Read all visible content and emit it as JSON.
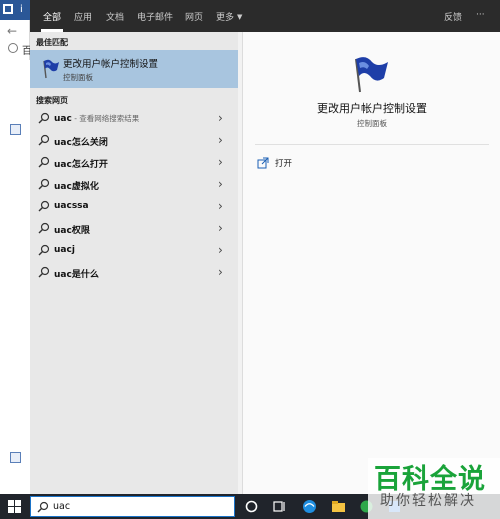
{
  "background_window": {
    "title_fragment": "i",
    "tab_fragment": "百"
  },
  "filter_tabs": [
    {
      "label": "全部",
      "active": true
    },
    {
      "label": "应用"
    },
    {
      "label": "文档"
    },
    {
      "label": "电子邮件"
    },
    {
      "label": "网页"
    },
    {
      "label": "更多"
    }
  ],
  "feedback_label": "反馈",
  "more_options_label": "···",
  "best_match": {
    "header": "最佳匹配",
    "title": "更改用户帐户控制设置",
    "subtitle": "控制面板",
    "icon": "uac-flag-icon"
  },
  "web_search": {
    "header": "搜索网页",
    "items": [
      {
        "query": "uac",
        "hint": " - 查看网络搜索结果"
      },
      {
        "query": "uac怎么关闭",
        "hint": ""
      },
      {
        "query": "uac怎么打开",
        "hint": ""
      },
      {
        "query": "uac虚拟化",
        "hint": ""
      },
      {
        "query": "uacssa",
        "hint": ""
      },
      {
        "query": "uac权限",
        "hint": ""
      },
      {
        "query": "uacj",
        "hint": ""
      },
      {
        "query": "uac是什么",
        "hint": ""
      }
    ]
  },
  "preview": {
    "title": "更改用户帐户控制设置",
    "subtitle": "控制面板",
    "action_label": "打开"
  },
  "taskbar": {
    "search_value": "uac",
    "icons": [
      "cortana-icon",
      "task-view-icon",
      "browser-icon",
      "file-explorer-icon",
      "app-icon",
      "app-icon-2"
    ]
  },
  "watermark": {
    "main": "百科全说",
    "sub": "助你轻松解决"
  },
  "colors": {
    "accent_selected": "#a8c5df",
    "topbar": "#2b2b2b",
    "taskbar": "#20242b",
    "watermark_green": "#1aa33a"
  }
}
